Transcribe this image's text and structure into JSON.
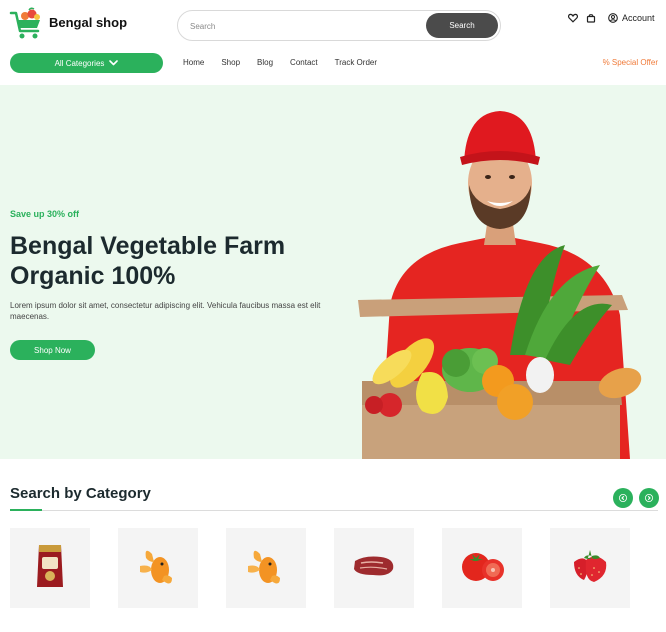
{
  "header": {
    "brand": "Bengal shop",
    "logo_icon": "shopping-cart-logo-icon",
    "search": {
      "placeholder": "Search",
      "button_label": "Search"
    },
    "icons": [
      "heart-icon",
      "bag-icon",
      "user-icon"
    ],
    "account_label": "Account"
  },
  "nav": {
    "categories_label": "All Categories",
    "items": [
      {
        "label": "Home"
      },
      {
        "label": "Shop"
      },
      {
        "label": "Blog"
      },
      {
        "label": "Contact"
      },
      {
        "label": "Track Order"
      }
    ],
    "special_offer": "% Special Offer"
  },
  "hero": {
    "save_text": "Save up 30% off",
    "title": "Bengal Vegetable Farm Organic 100%",
    "text": "Lorem ipsum dolor sit amet, consectetur adipiscing elit. Vehicula faucibus massa est elit maecenas.",
    "button_label": "Shop Now",
    "image_icon": "delivery-man-with-grocery-box-image"
  },
  "category_section": {
    "title": "Search by Category",
    "items": [
      {
        "icon": "snack-pack-icon"
      },
      {
        "icon": "goldfish-icon"
      },
      {
        "icon": "goldfish-icon"
      },
      {
        "icon": "raw-meat-icon"
      },
      {
        "icon": "tomato-icon"
      },
      {
        "icon": "strawberry-icon"
      }
    ]
  },
  "colors": {
    "accent": "#2bb15c",
    "hero_bg": "#ecf9ee",
    "special": "#f07b3a",
    "search_button": "#4b4b4b"
  }
}
